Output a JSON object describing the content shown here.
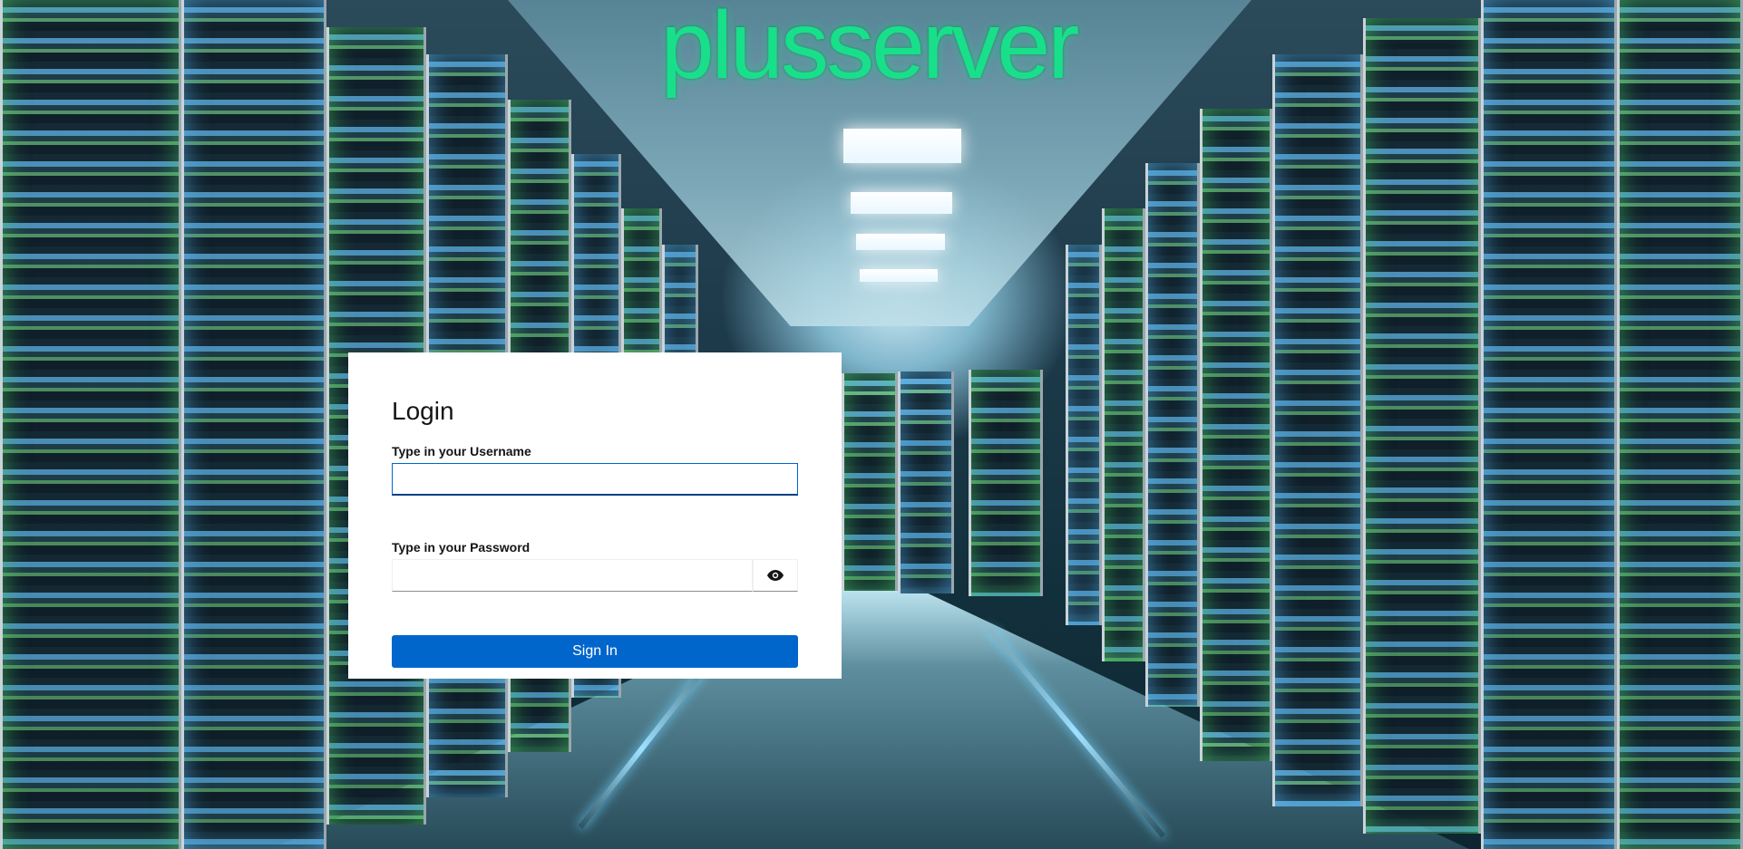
{
  "brand": {
    "logo_text": "plusserver",
    "logo_color": "#18e08a"
  },
  "login": {
    "title": "Login",
    "username_label": "Type in your Username",
    "username_value": "",
    "password_label": "Type in your Password",
    "password_value": "",
    "toggle_icon": "eye-icon",
    "submit_label": "Sign In",
    "accent_color": "#0066cc"
  }
}
